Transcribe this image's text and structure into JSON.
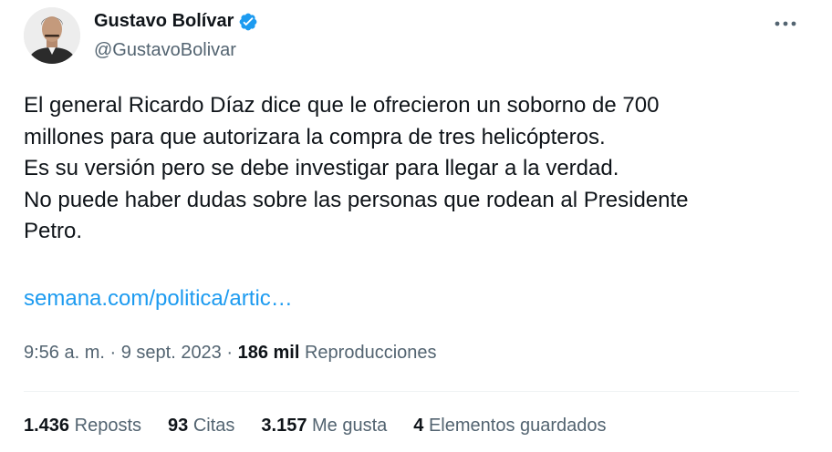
{
  "author": {
    "name": "Gustavo Bolívar",
    "handle": "@GustavoBolivar",
    "verified_color": "#1d9bf0"
  },
  "tweet": {
    "lines": [
      "El general Ricardo Díaz dice que le ofrecieron un soborno de 700",
      "millones para que autorizara la compra de tres helicópteros.",
      "Es su versión pero se debe investigar para llegar a la verdad.",
      "No puede haber dudas sobre las personas que rodean al Presidente",
      "Petro."
    ],
    "link": "semana.com/politica/artic…"
  },
  "meta": {
    "time": "9:56 a. m.",
    "sep1": " · ",
    "date": "9 sept. 2023",
    "sep2": " · ",
    "views_count": "186 mil",
    "views_label": "Reproducciones"
  },
  "stats": {
    "reposts_count": "1.436",
    "reposts_label": "Reposts",
    "quotes_count": "93",
    "quotes_label": "Citas",
    "likes_count": "3.157",
    "likes_label": "Me gusta",
    "bookmarks_count": "4",
    "bookmarks_label": "Elementos guardados"
  },
  "icons": {
    "more": "more-horizontal-icon",
    "verified": "verified-badge-icon"
  }
}
